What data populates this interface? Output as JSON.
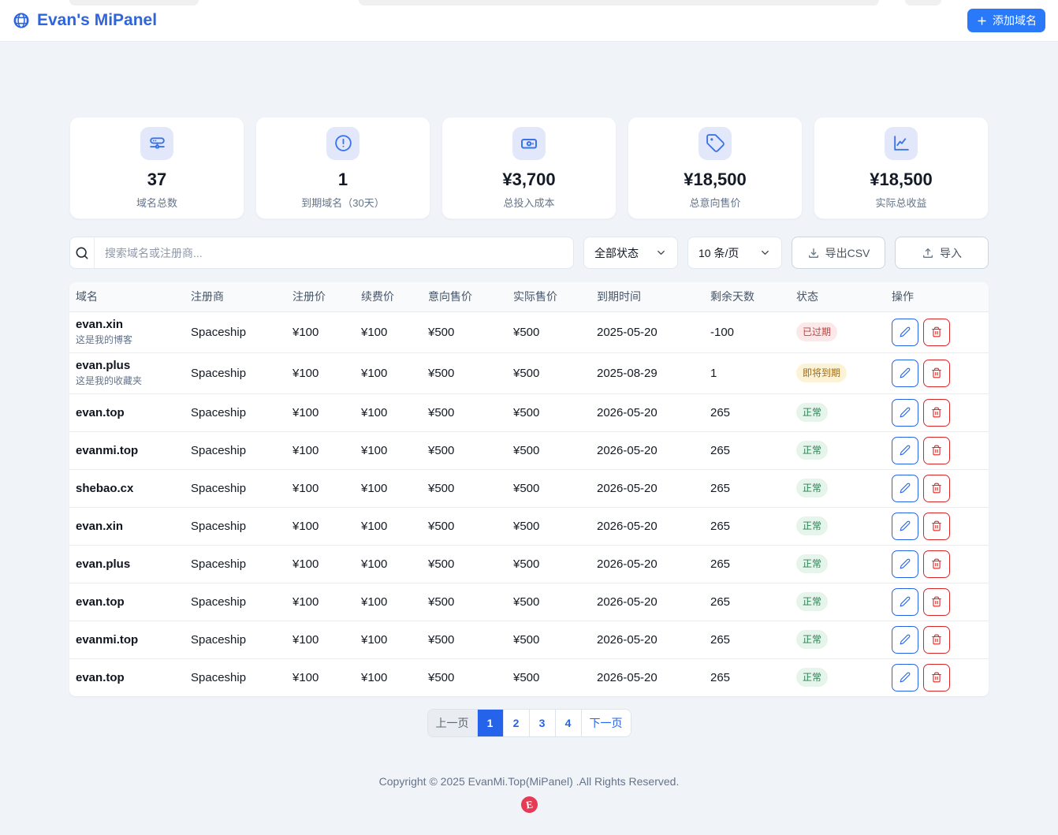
{
  "header": {
    "title": "Evan's MiPanel",
    "add_button": "添加域名"
  },
  "stats": [
    {
      "icon": "server-icon",
      "value": "37",
      "label": "域名总数"
    },
    {
      "icon": "alert-icon",
      "value": "1",
      "label": "到期域名（30天）"
    },
    {
      "icon": "banknote-icon",
      "value": "¥3,700",
      "label": "总投入成本"
    },
    {
      "icon": "tag-icon",
      "value": "¥18,500",
      "label": "总意向售价"
    },
    {
      "icon": "chart-icon",
      "value": "¥18,500",
      "label": "实际总收益"
    }
  ],
  "filters": {
    "search_placeholder": "搜索域名或注册商...",
    "status_select": "全部状态",
    "page_size_select": "10 条/页",
    "export_button": "导出CSV",
    "import_button": "导入"
  },
  "table": {
    "columns": [
      "域名",
      "注册商",
      "注册价",
      "续费价",
      "意向售价",
      "实际售价",
      "到期时间",
      "剩余天数",
      "状态",
      "操作"
    ],
    "rows": [
      {
        "domain": "evan.xin",
        "note": "这是我的博客",
        "registrar": "Spaceship",
        "reg_price": "¥100",
        "renew_price": "¥100",
        "ask_price": "¥500",
        "sold_price": "¥500",
        "expire": "2025-05-20",
        "days": "-100",
        "status": "已过期",
        "status_type": "expired"
      },
      {
        "domain": "evan.plus",
        "note": "这是我的收藏夹",
        "registrar": "Spaceship",
        "reg_price": "¥100",
        "renew_price": "¥100",
        "ask_price": "¥500",
        "sold_price": "¥500",
        "expire": "2025-08-29",
        "days": "1",
        "status": "即将到期",
        "status_type": "expiring"
      },
      {
        "domain": "evan.top",
        "note": "",
        "registrar": "Spaceship",
        "reg_price": "¥100",
        "renew_price": "¥100",
        "ask_price": "¥500",
        "sold_price": "¥500",
        "expire": "2026-05-20",
        "days": "265",
        "status": "正常",
        "status_type": "normal"
      },
      {
        "domain": "evanmi.top",
        "note": "",
        "registrar": "Spaceship",
        "reg_price": "¥100",
        "renew_price": "¥100",
        "ask_price": "¥500",
        "sold_price": "¥500",
        "expire": "2026-05-20",
        "days": "265",
        "status": "正常",
        "status_type": "normal"
      },
      {
        "domain": "shebao.cx",
        "note": "",
        "registrar": "Spaceship",
        "reg_price": "¥100",
        "renew_price": "¥100",
        "ask_price": "¥500",
        "sold_price": "¥500",
        "expire": "2026-05-20",
        "days": "265",
        "status": "正常",
        "status_type": "normal"
      },
      {
        "domain": "evan.xin",
        "note": "",
        "registrar": "Spaceship",
        "reg_price": "¥100",
        "renew_price": "¥100",
        "ask_price": "¥500",
        "sold_price": "¥500",
        "expire": "2026-05-20",
        "days": "265",
        "status": "正常",
        "status_type": "normal"
      },
      {
        "domain": "evan.plus",
        "note": "",
        "registrar": "Spaceship",
        "reg_price": "¥100",
        "renew_price": "¥100",
        "ask_price": "¥500",
        "sold_price": "¥500",
        "expire": "2026-05-20",
        "days": "265",
        "status": "正常",
        "status_type": "normal"
      },
      {
        "domain": "evan.top",
        "note": "",
        "registrar": "Spaceship",
        "reg_price": "¥100",
        "renew_price": "¥100",
        "ask_price": "¥500",
        "sold_price": "¥500",
        "expire": "2026-05-20",
        "days": "265",
        "status": "正常",
        "status_type": "normal"
      },
      {
        "domain": "evanmi.top",
        "note": "",
        "registrar": "Spaceship",
        "reg_price": "¥100",
        "renew_price": "¥100",
        "ask_price": "¥500",
        "sold_price": "¥500",
        "expire": "2026-05-20",
        "days": "265",
        "status": "正常",
        "status_type": "normal"
      },
      {
        "domain": "evan.top",
        "note": "",
        "registrar": "Spaceship",
        "reg_price": "¥100",
        "renew_price": "¥100",
        "ask_price": "¥500",
        "sold_price": "¥500",
        "expire": "2026-05-20",
        "days": "265",
        "status": "正常",
        "status_type": "normal"
      }
    ],
    "edit_action": "edit",
    "delete_action": "delete"
  },
  "pagination": {
    "prev": "上一页",
    "pages": [
      "1",
      "2",
      "3",
      "4"
    ],
    "active": "1",
    "next": "下一页"
  },
  "footer": {
    "copyright": "Copyright © 2025 EvanMi.Top(MiPanel) .All Rights Reserved.",
    "logo_letter": "E"
  },
  "colors": {
    "accent_blue": "#2563eb",
    "button_blue": "#2b7fff",
    "status_expired_text": "#d03333",
    "status_expiring_text": "#ad6410",
    "status_normal_text": "#1ea355",
    "logo_red": "#e73a55"
  }
}
